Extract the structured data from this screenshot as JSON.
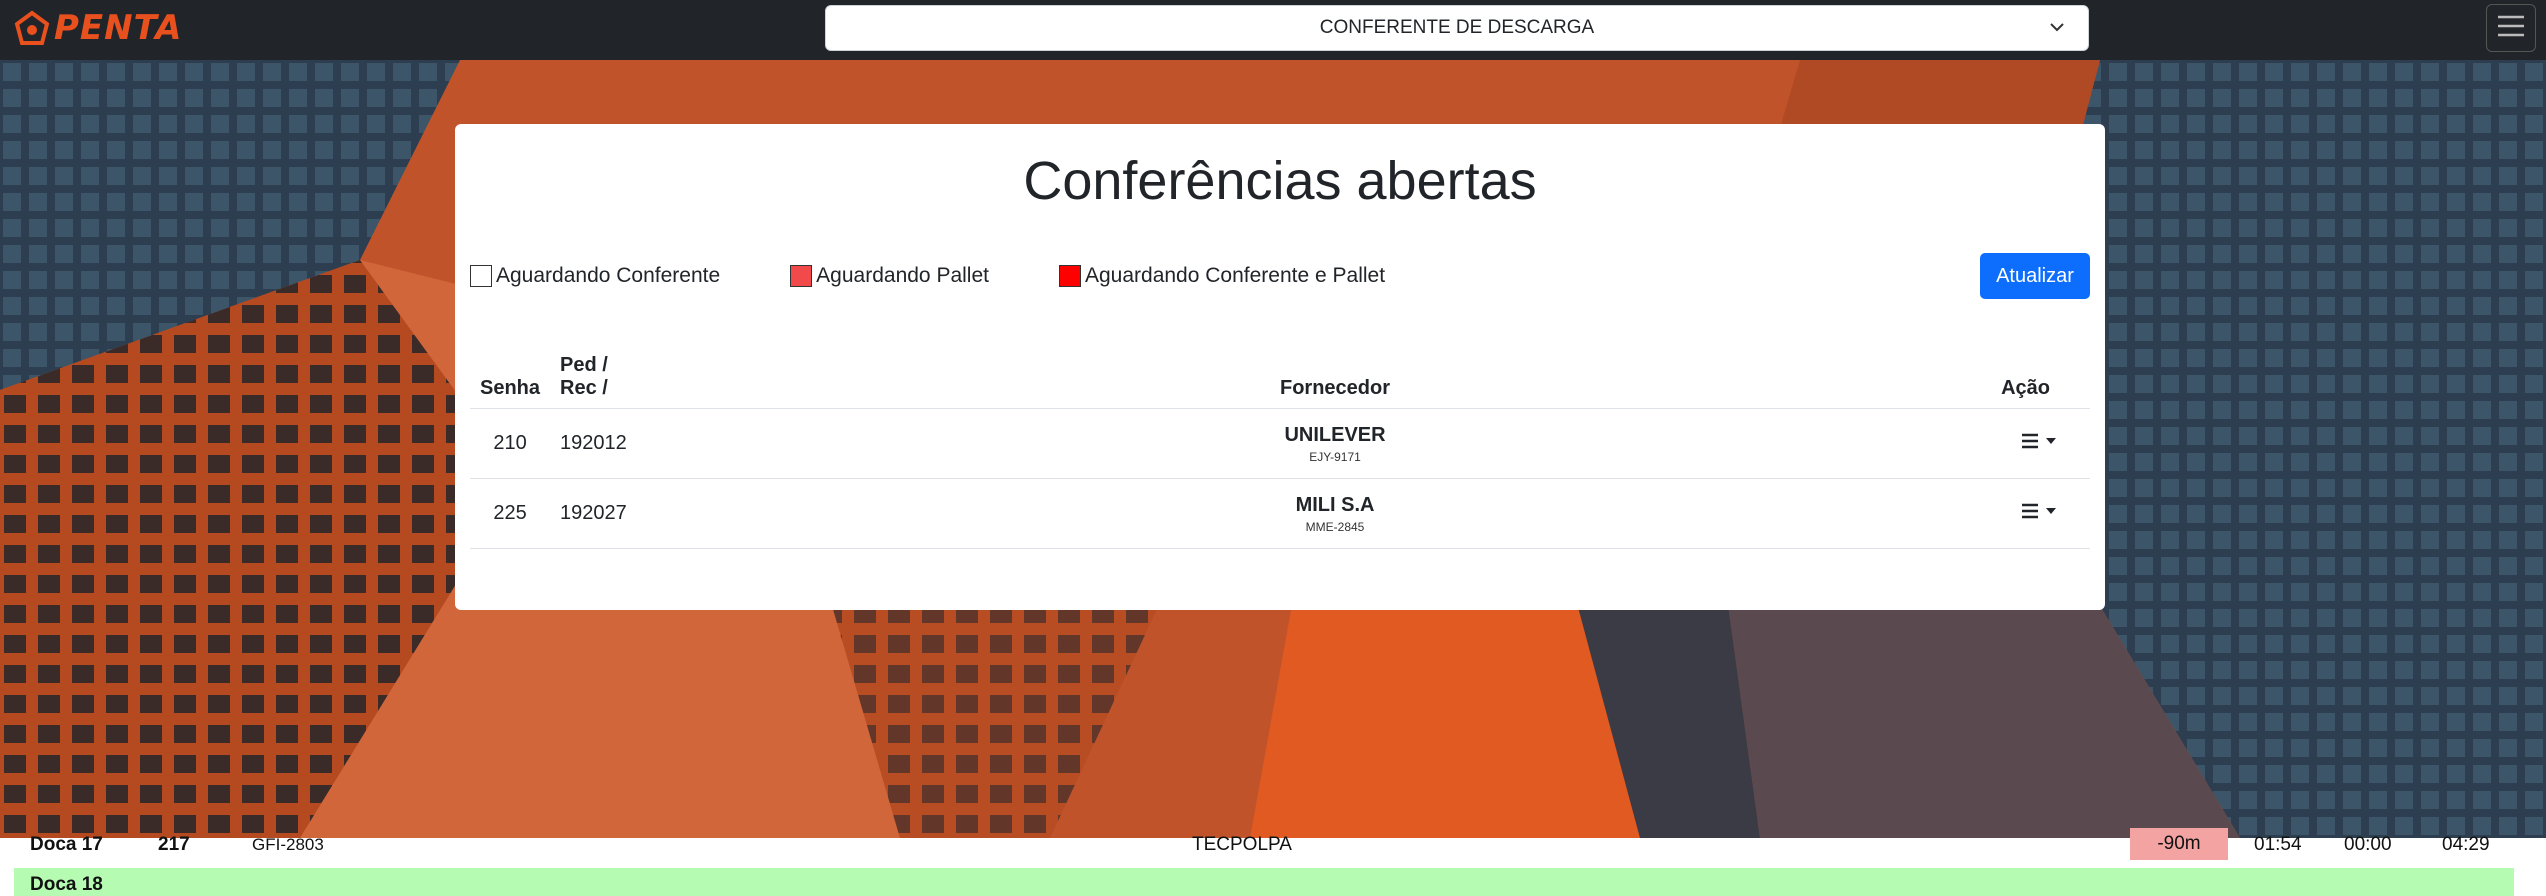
{
  "brand": {
    "name": "PENTA"
  },
  "role_select": {
    "value": "CONFERENTE DE DESCARGA"
  },
  "page_title": "Conferências abertas",
  "legend": [
    {
      "label": "Aguardando Conferente",
      "color": "#ffffff"
    },
    {
      "label": "Aguardando Pallet",
      "color": "#f24a4a"
    },
    {
      "label": "Aguardando Conferente e Pallet",
      "color": "#ff0000"
    }
  ],
  "refresh_label": "Atualizar",
  "table": {
    "headers": {
      "senha": "Senha",
      "ped_line1": "Ped /",
      "ped_line2": "Rec /",
      "fornecedor": "Fornecedor",
      "acao": "Ação"
    },
    "rows": [
      {
        "senha": "210",
        "ped": "192012",
        "fornecedor": "UNILEVER",
        "placa": "EJY-9171"
      },
      {
        "senha": "225",
        "ped": "192027",
        "fornecedor": "MILI S.A",
        "placa": "MME-2845"
      }
    ]
  },
  "background_rows": [
    {
      "doca": "Doca 17",
      "senha": "217",
      "placa": "GFI-2803",
      "fornecedor": "TECPOLPA",
      "delta": "-90m",
      "t1": "01:54",
      "t2": "00:00",
      "t3": "04:29"
    },
    {
      "doca": "Doca 18"
    }
  ],
  "colors": {
    "brand": "#e8501e",
    "primary": "#0d6efd",
    "topbar": "#212529",
    "late": "#f4a3a3",
    "ok_row": "#b6fbb2"
  }
}
